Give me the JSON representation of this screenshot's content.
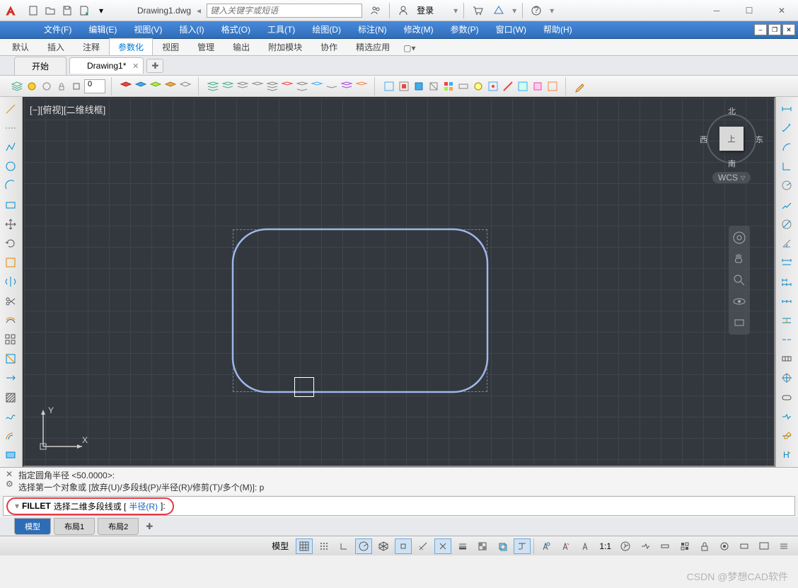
{
  "titlebar": {
    "doc_title": "Drawing1.dwg",
    "search_placeholder": "键入关键字或短语",
    "login": "登录"
  },
  "menubar": {
    "items": [
      "文件(F)",
      "编辑(E)",
      "视图(V)",
      "插入(I)",
      "格式(O)",
      "工具(T)",
      "绘图(D)",
      "标注(N)",
      "修改(M)",
      "参数(P)",
      "窗口(W)",
      "帮助(H)"
    ]
  },
  "ribbon": {
    "tabs": [
      "默认",
      "插入",
      "注释",
      "参数化",
      "视图",
      "管理",
      "输出",
      "附加模块",
      "协作",
      "精选应用"
    ],
    "active": 3
  },
  "doc_tabs": {
    "start": "开始",
    "active": "Drawing1*"
  },
  "layer": {
    "current": "0"
  },
  "canvas": {
    "view_label": "[−][俯视][二维线框]",
    "compass": {
      "n": "北",
      "e": "东",
      "s": "南",
      "w": "西"
    },
    "cube_face": "上",
    "wcs": "WCS"
  },
  "cmd": {
    "line1": "指定圆角半径 <50.0000>:",
    "line2": "选择第一个对象或 [放弃(U)/多段线(P)/半径(R)/修剪(T)/多个(M)]: p",
    "prompt_cmd": "FILLET",
    "prompt_text1": "选择二维多段线或 [",
    "prompt_opt": "半径(R)",
    "prompt_text2": "]:"
  },
  "layout": {
    "tabs": [
      "模型",
      "布局1",
      "布局2"
    ]
  },
  "status": {
    "model": "模型",
    "scale": "1:1"
  },
  "watermark": "CSDN @梦想CAD软件"
}
